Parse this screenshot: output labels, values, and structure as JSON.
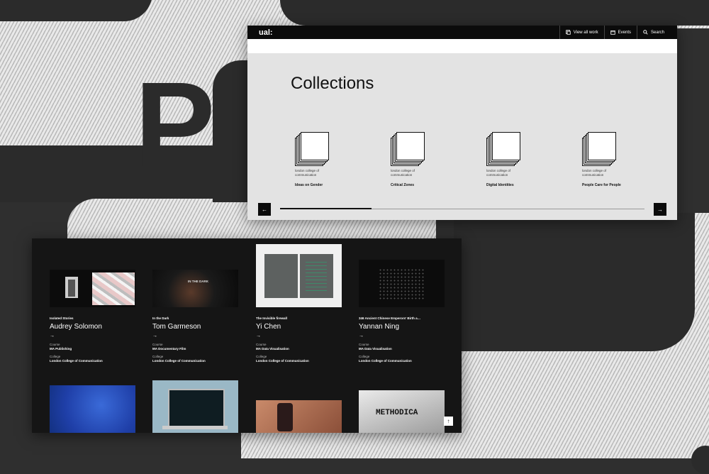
{
  "top_window": {
    "logo": "ual:",
    "nav": [
      {
        "label": "View all work",
        "icon": "grid-icon"
      },
      {
        "label": "Events",
        "icon": "calendar-icon"
      },
      {
        "label": "Search",
        "icon": "search-icon"
      }
    ],
    "heading": "Collections",
    "collections": [
      {
        "subtitle": "london college of communication",
        "title": "Ideas on Gender"
      },
      {
        "subtitle": "london college of communication",
        "title": "Critical Zones"
      },
      {
        "subtitle": "london college of communication",
        "title": "Digital Identities"
      },
      {
        "subtitle": "london college of communication",
        "title": "People Care for People"
      }
    ],
    "prev_arrow": "←",
    "next_arrow": "→",
    "carousel_progress": 0.25
  },
  "bottom_window": {
    "course_label": "Course",
    "college_label": "College",
    "arrow": "→",
    "cards": [
      {
        "project": "Isolated Stories",
        "name": "Audrey Solomon",
        "course": "MA Publishing",
        "college": "London College of Communication"
      },
      {
        "project": "In the Dark",
        "name": "Tom Garmeson",
        "course": "MA Documentary Film",
        "college": "London College of Communication",
        "thumb_text": "IN THE DARK"
      },
      {
        "project": "The Invisible firewall",
        "name": "Yi Chen",
        "course": "MA Data Visualisation",
        "college": "London College of Communication"
      },
      {
        "project": "346 Ancient Chinese Emperors' Birth a…",
        "name": "Yannan Ning",
        "course": "MA Data Visualisation",
        "college": "London College of Communication"
      }
    ],
    "row2_thumb_text": "METHODICA",
    "scroll_top": "↑"
  },
  "background_letter": "P"
}
